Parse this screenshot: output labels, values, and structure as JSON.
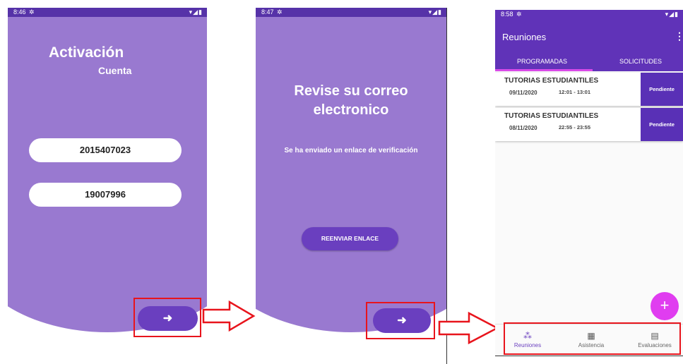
{
  "screen1": {
    "status_time": "8:46",
    "title": "Activación",
    "subtitle": "Cuenta",
    "field1_value": "2015407023",
    "field2_value": "19007996",
    "next_icon": "arrow-right-icon"
  },
  "screen2": {
    "status_time": "8:47",
    "title_line1": "Revise su correo",
    "title_line2": "electronico",
    "message": "Se ha enviado un enlace de verificación",
    "resend_label": "REENVIAR ENLACE",
    "next_icon": "arrow-right-icon"
  },
  "screen3": {
    "status_time": "8:58",
    "app_title": "Reuniones",
    "tabs": [
      {
        "label": "PROGRAMADAS"
      },
      {
        "label": "SOLICITUDES"
      }
    ],
    "meetings": [
      {
        "name": "TUTORIAS ESTUDIANTILES",
        "date": "09/11/2020",
        "hours": "12:01 - 13:01",
        "status": "Pendiente"
      },
      {
        "name": "TUTORIAS ESTUDIANTILES",
        "date": "08/11/2020",
        "hours": "22:55 - 23:55",
        "status": "Pendiente"
      }
    ],
    "fab_label": "+",
    "nav": [
      {
        "label": "Reuniones",
        "icon": "meetings-icon"
      },
      {
        "label": "Asistencia",
        "icon": "calendar-icon"
      },
      {
        "label": "Evaluaciones",
        "icon": "evaluation-icon"
      }
    ]
  },
  "colors": {
    "background_purple": "#9979d0",
    "status_bar": "#5632a8",
    "button_purple": "#6a3fbf",
    "fab_pink": "#e03df0",
    "annotation_red": "#e8141c"
  }
}
